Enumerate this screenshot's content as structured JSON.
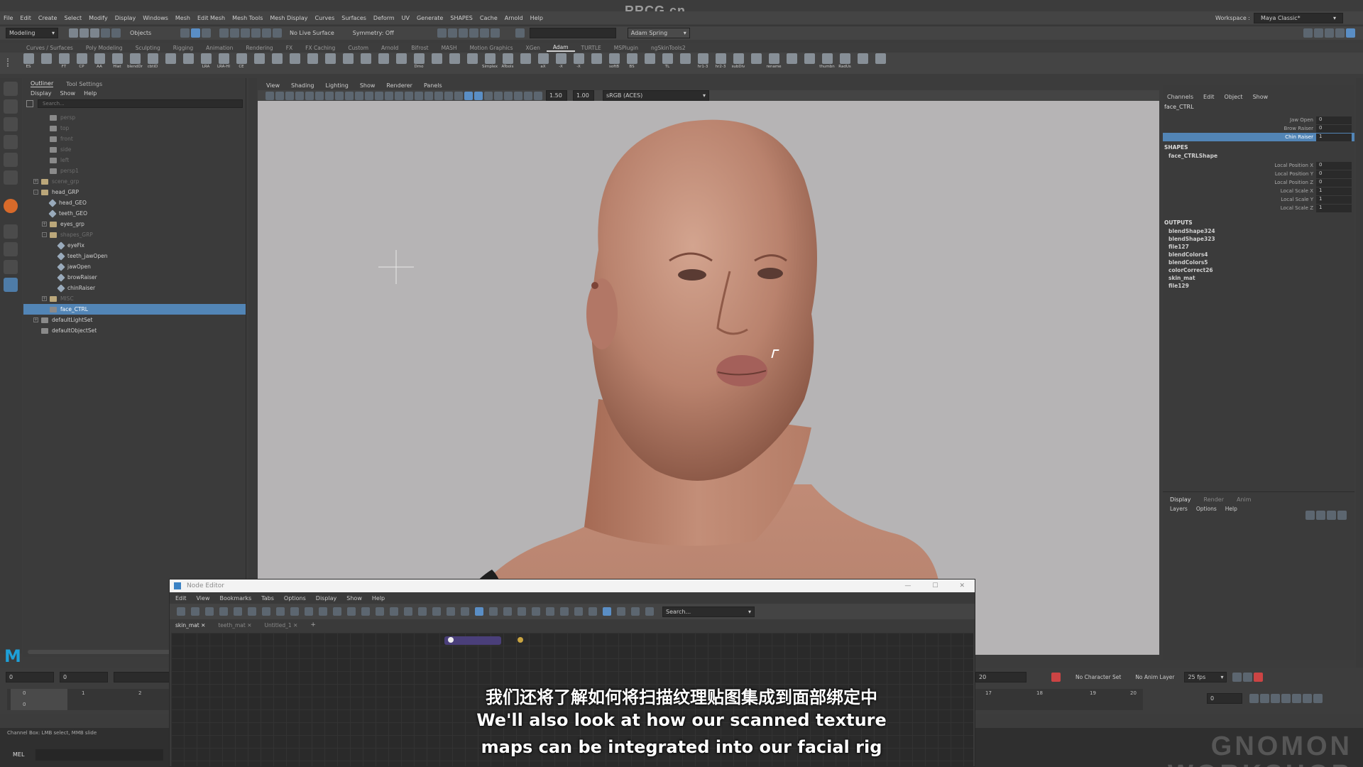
{
  "site_watermark": "RRCG.cn",
  "menus": [
    "File",
    "Edit",
    "Create",
    "Select",
    "Modify",
    "Display",
    "Windows",
    "Mesh",
    "Edit Mesh",
    "Mesh Tools",
    "Mesh Display",
    "Curves",
    "Surfaces",
    "Deform",
    "UV",
    "Generate",
    "SHAPES",
    "Cache",
    "Arnold",
    "Help"
  ],
  "workspace": {
    "label": "Workspace :",
    "value": "Maya Classic*"
  },
  "status": {
    "mode": "Modeling",
    "objects": "Objects",
    "live_surface": "No Live Surface",
    "symmetry": "Symmetry: Off",
    "user": "Adam Spring"
  },
  "shelf_tabs": [
    "Curves / Surfaces",
    "Poly Modeling",
    "Sculpting",
    "Rigging",
    "Animation",
    "Rendering",
    "FX",
    "FX Caching",
    "Custom",
    "Arnold",
    "Bifrost",
    "MASH",
    "Motion Graphics",
    "XGen",
    "Adam",
    "TURTLE",
    "MSPlugin",
    "ngSkinTools2"
  ],
  "shelf_active": "Adam",
  "shelf_items": [
    "ES",
    "",
    "FT",
    "CP",
    "AA",
    "Hlat",
    "blendDr",
    "cbtiD",
    "",
    "",
    "LRA",
    "LRA-HI",
    "CE",
    "",
    "",
    "",
    "",
    "",
    "",
    "",
    "",
    "",
    "Dmo",
    "",
    "",
    "",
    "Simplex",
    "ATools",
    "",
    "aX",
    "-X",
    "-X",
    "",
    "softB",
    "BS",
    "",
    "TL",
    "",
    "hr1-3",
    "hr2-3",
    "subDiv",
    "",
    "rename",
    "",
    "",
    "thumbn",
    "RadUs",
    "",
    ""
  ],
  "outliner": {
    "tabs": [
      "Outliner",
      "Tool Settings"
    ],
    "menu": [
      "Display",
      "Show",
      "Help"
    ],
    "search_placeholder": "Search...",
    "items": [
      {
        "label": "persp",
        "indent": 1,
        "dim": true,
        "icon": "camera"
      },
      {
        "label": "top",
        "indent": 1,
        "dim": true,
        "icon": "camera"
      },
      {
        "label": "front",
        "indent": 1,
        "dim": true,
        "icon": "camera"
      },
      {
        "label": "side",
        "indent": 1,
        "dim": true,
        "icon": "camera"
      },
      {
        "label": "left",
        "indent": 1,
        "dim": true,
        "icon": "camera"
      },
      {
        "label": "persp1",
        "indent": 1,
        "dim": true,
        "icon": "camera"
      },
      {
        "label": "scene_grp",
        "indent": 0,
        "dim": true,
        "icon": "group",
        "exp": "+"
      },
      {
        "label": "head_GRP",
        "indent": 0,
        "icon": "group",
        "exp": "-"
      },
      {
        "label": "head_GEO",
        "indent": 1,
        "icon": "mesh"
      },
      {
        "label": "teeth_GEO",
        "indent": 1,
        "icon": "mesh"
      },
      {
        "label": "eyes_grp",
        "indent": 1,
        "icon": "group",
        "exp": "+"
      },
      {
        "label": "shapes_GRP",
        "indent": 1,
        "dim": true,
        "icon": "group",
        "exp": "-"
      },
      {
        "label": "eyeFix",
        "indent": 2,
        "icon": "mesh"
      },
      {
        "label": "teeth_jawOpen",
        "indent": 2,
        "icon": "mesh"
      },
      {
        "label": "jawOpen",
        "indent": 2,
        "icon": "mesh"
      },
      {
        "label": "browRaiser",
        "indent": 2,
        "icon": "mesh"
      },
      {
        "label": "chinRaiser",
        "indent": 2,
        "icon": "mesh"
      },
      {
        "label": "MISC",
        "indent": 1,
        "dim": true,
        "icon": "group",
        "exp": "+"
      },
      {
        "label": "face_CTRL",
        "indent": 1,
        "icon": "ctrl",
        "selected": true
      },
      {
        "label": "defaultLightSet",
        "indent": 0,
        "icon": "set",
        "exp": "+"
      },
      {
        "label": "defaultObjectSet",
        "indent": 0,
        "icon": "set"
      }
    ]
  },
  "viewport": {
    "menu": [
      "View",
      "Shading",
      "Lighting",
      "Show",
      "Renderer",
      "Panels"
    ],
    "field_a": "1.50",
    "field_b": "1.00",
    "colorspace": "sRGB (ACES)"
  },
  "channel_box": {
    "menu": [
      "Channels",
      "Edit",
      "Object",
      "Show"
    ],
    "object": "face_CTRL",
    "channels": [
      {
        "name": "Jaw Open",
        "value": "0"
      },
      {
        "name": "Brow Raiser",
        "value": "0"
      },
      {
        "name": "Chin Raiser",
        "value": "1",
        "selected": true
      }
    ],
    "shapes_header": "SHAPES",
    "shape_name": "face_CTRLShape",
    "shape_channels": [
      {
        "name": "Local Position X",
        "value": "0"
      },
      {
        "name": "Local Position Y",
        "value": "0"
      },
      {
        "name": "Local Position Z",
        "value": "0"
      },
      {
        "name": "Local Scale X",
        "value": "1"
      },
      {
        "name": "Local Scale Y",
        "value": "1"
      },
      {
        "name": "Local Scale Z",
        "value": "1"
      }
    ],
    "outputs_header": "OUTPUTS",
    "outputs": [
      "blendShape324",
      "blendShape323",
      "file127",
      "blendColors4",
      "blendColors5",
      "colorCorrect26",
      "skin_mat",
      "file129"
    ]
  },
  "layer_editor": {
    "tabs": [
      "Display",
      "Render",
      "Anim"
    ],
    "menu": [
      "Layers",
      "Options",
      "Help"
    ]
  },
  "node_editor": {
    "title": "Node Editor",
    "menu": [
      "Edit",
      "View",
      "Bookmarks",
      "Tabs",
      "Options",
      "Display",
      "Show",
      "Help"
    ],
    "search_placeholder": "Search...",
    "tabs": [
      "skin_mat",
      "teeth_mat",
      "Untitled_1"
    ]
  },
  "timeline": {
    "start": "0",
    "start2": "0",
    "frame": "0",
    "end": "20",
    "ticks": [
      "0",
      "1",
      "2",
      "17",
      "18",
      "19",
      "20"
    ],
    "character_set": "No Character Set",
    "anim_layer": "No Anim Layer",
    "fps": "25 fps"
  },
  "command": {
    "mel": "MEL",
    "help": "Channel Box: LMB select, MMB slide"
  },
  "subtitles": {
    "zh": "我们还将了解如何将扫描纹理贴图集成到面部绑定中",
    "en1": "We'll also look at how our scanned texture",
    "en2": "maps can be integrated into our facial rig"
  },
  "bottom_brand": "GNOMON WORKSHOP",
  "colors": {
    "selection": "#5285b6",
    "viewport_bg": "#b6b4b5",
    "skin": "#c99784"
  }
}
